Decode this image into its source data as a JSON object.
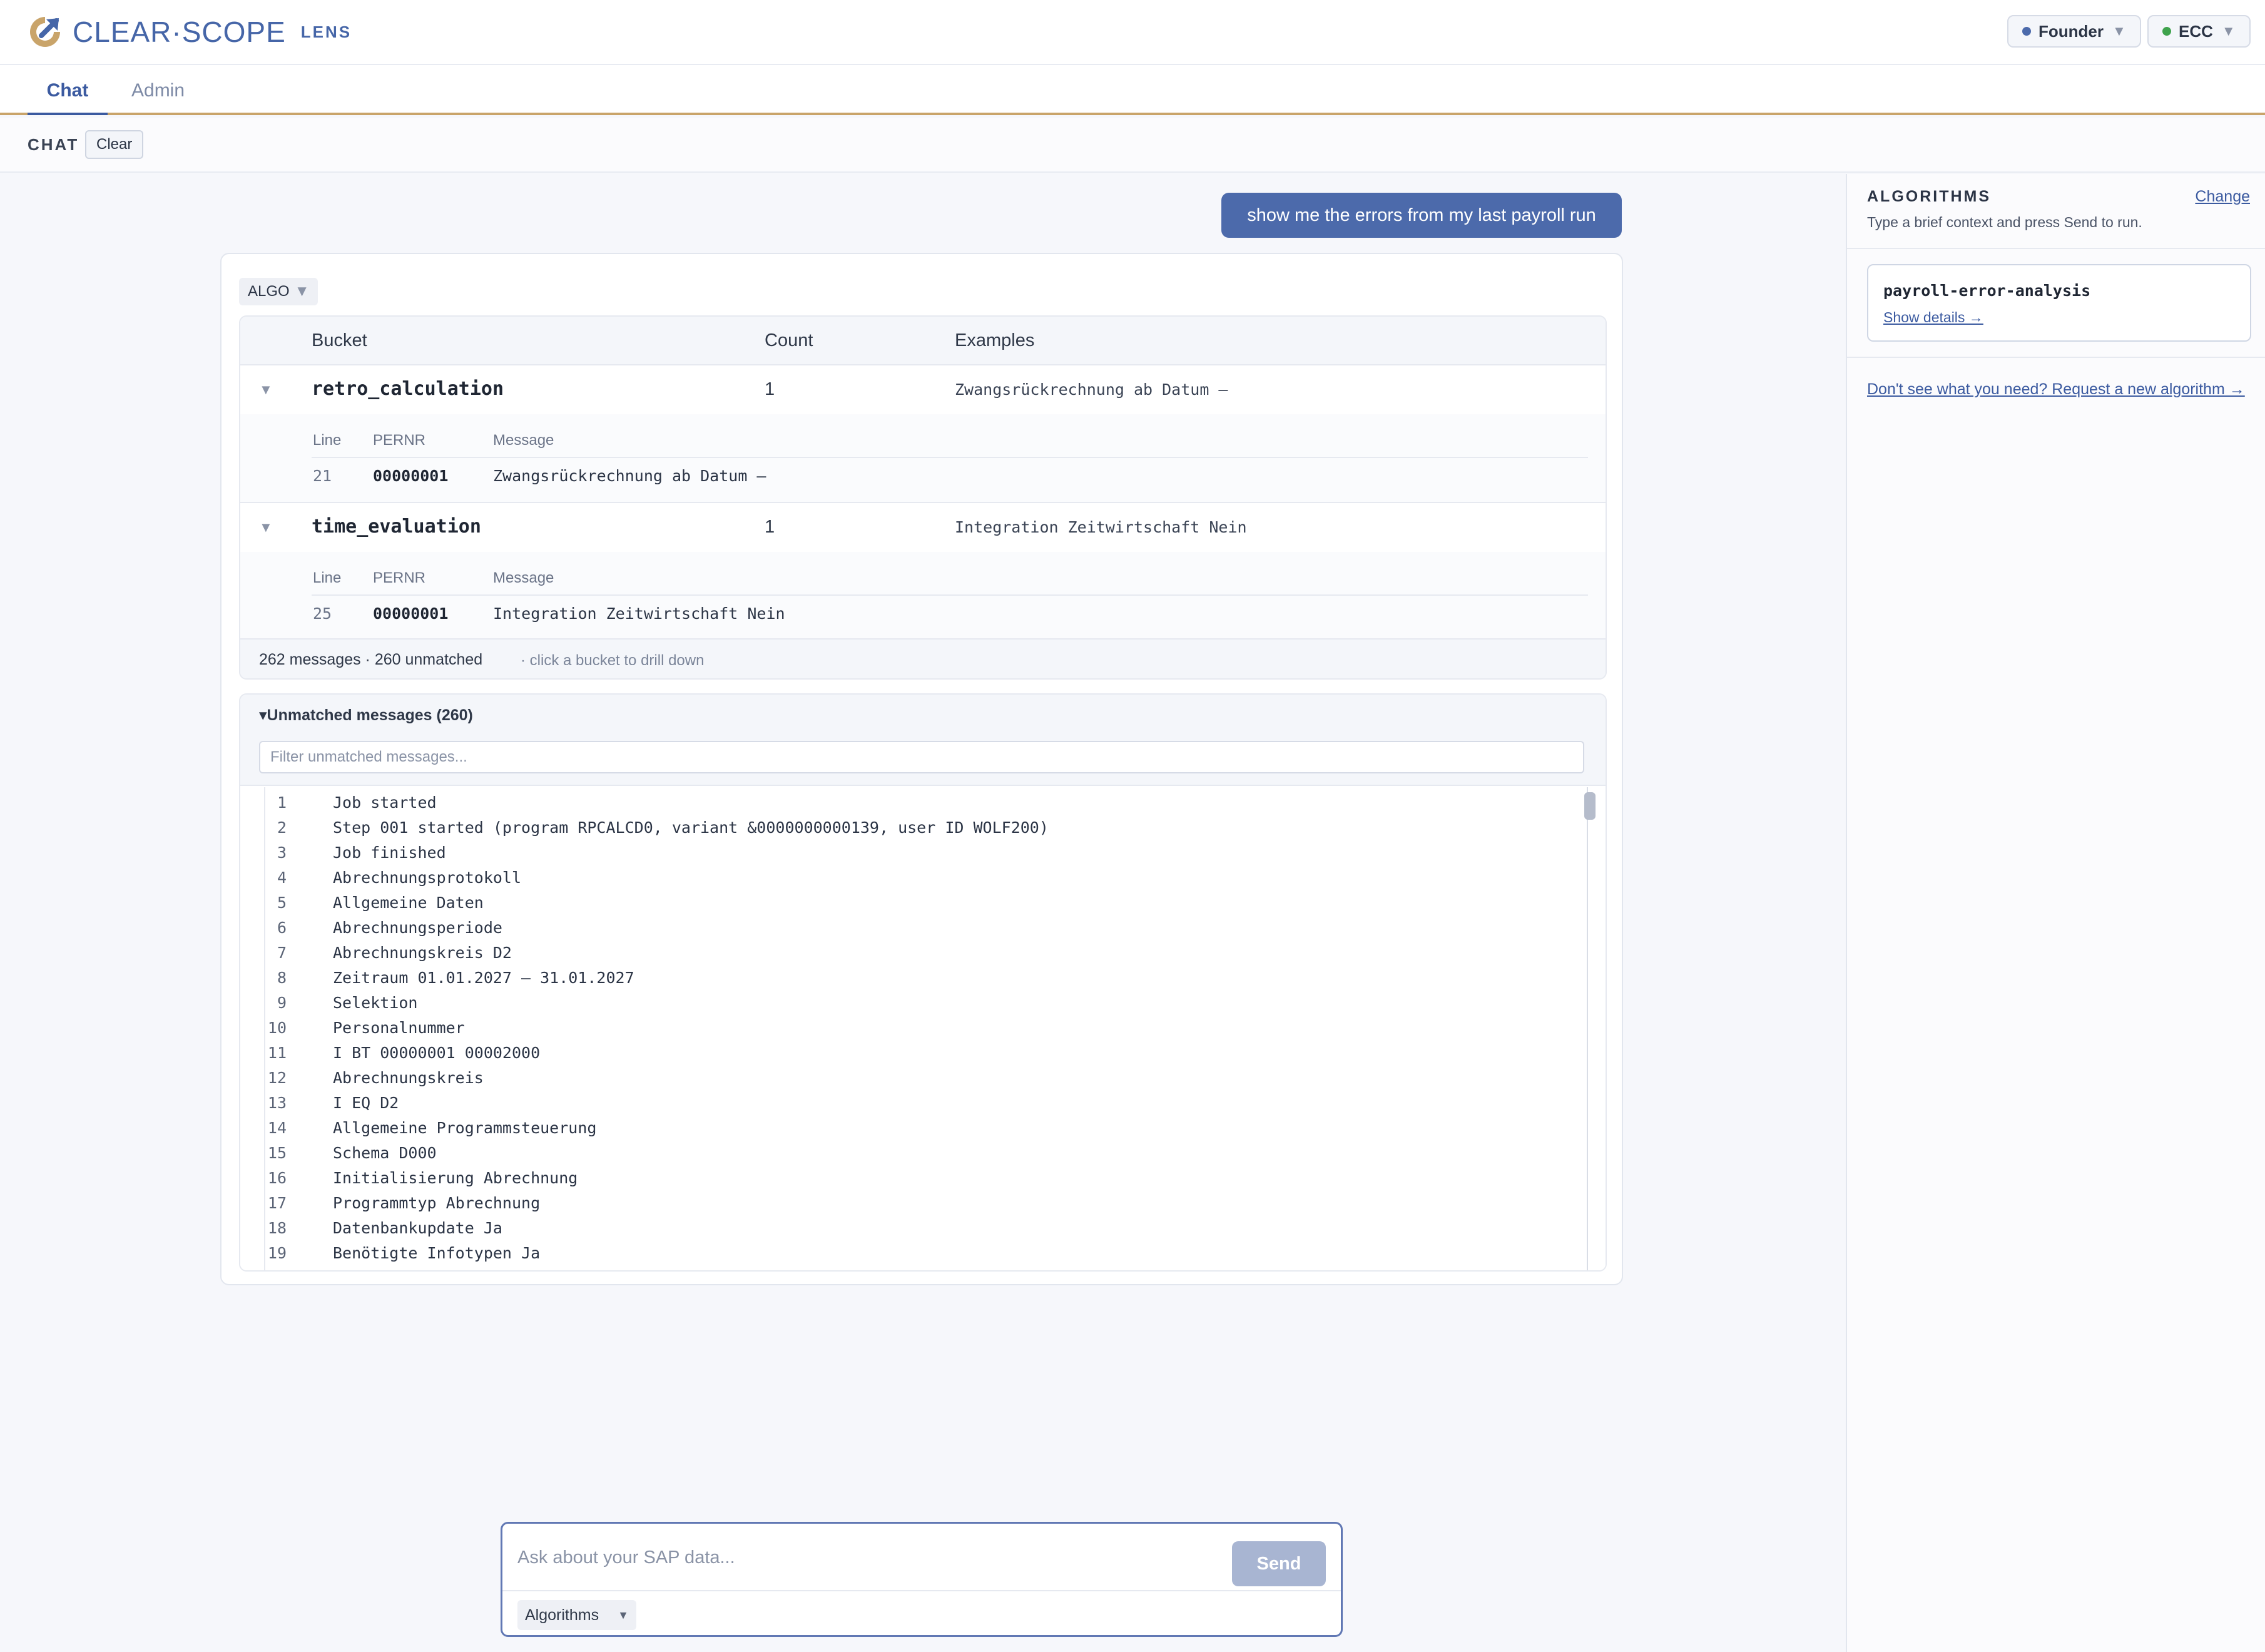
{
  "header": {
    "brand": "CLEAR·SCOPE",
    "brand_sub": "LENS",
    "role_pill": {
      "label": "Founder",
      "dot_color": "#4c6aab"
    },
    "system_pill": {
      "label": "ECC",
      "dot_color": "#3fa34d"
    }
  },
  "tabs": [
    {
      "label": "Chat",
      "active": true
    },
    {
      "label": "Admin",
      "active": false
    }
  ],
  "chat_bar": {
    "label": "CHAT",
    "clear_label": "Clear"
  },
  "conversation": {
    "user_message": "show me the errors from my last payroll run",
    "result": {
      "algo_tag": "ALGO",
      "columns": {
        "bucket": "Bucket",
        "count": "Count",
        "examples": "Examples"
      },
      "detail_columns": {
        "line": "Line",
        "pernr": "PERNR",
        "message": "Message"
      },
      "buckets": [
        {
          "name": "retro_calculation",
          "count": "1",
          "example": "Zwangsrückrechnung ab Datum –",
          "rows": [
            {
              "line": "21",
              "pernr": "00000001",
              "message": "Zwangsrückrechnung ab Datum –"
            }
          ]
        },
        {
          "name": "time_evaluation",
          "count": "1",
          "example": "Integration Zeitwirtschaft Nein",
          "rows": [
            {
              "line": "25",
              "pernr": "00000001",
              "message": "Integration Zeitwirtschaft Nein"
            }
          ]
        }
      ],
      "summary": "262 messages · 260 unmatched",
      "hint": "· click a bucket to drill down",
      "unmatched": {
        "title": "▾Unmatched messages (260)",
        "filter_placeholder": "Filter unmatched messages...",
        "lines": [
          {
            "n": "1",
            "text": "Job started"
          },
          {
            "n": "2",
            "text": "Step 001 started (program RPCALCD0, variant &0000000000139, user ID WOLF200)"
          },
          {
            "n": "3",
            "text": "Job finished"
          },
          {
            "n": "4",
            "text": "Abrechnungsprotokoll"
          },
          {
            "n": "5",
            "text": "Allgemeine Daten"
          },
          {
            "n": "6",
            "text": "Abrechnungsperiode"
          },
          {
            "n": "7",
            "text": "Abrechnungskreis D2"
          },
          {
            "n": "8",
            "text": "Zeitraum 01.01.2027 – 31.01.2027"
          },
          {
            "n": "9",
            "text": "Selektion"
          },
          {
            "n": "10",
            "text": "Personalnummer"
          },
          {
            "n": "11",
            "text": "I BT 00000001 00002000"
          },
          {
            "n": "12",
            "text": "Abrechnungskreis"
          },
          {
            "n": "13",
            "text": "I EQ D2"
          },
          {
            "n": "14",
            "text": "Allgemeine Programmsteuerung"
          },
          {
            "n": "15",
            "text": "Schema D000"
          },
          {
            "n": "16",
            "text": "Initialisierung Abrechnung"
          },
          {
            "n": "17",
            "text": "Programmtyp Abrechnung"
          },
          {
            "n": "18",
            "text": "Datenbankupdate Ja"
          },
          {
            "n": "19",
            "text": "Benötigte Infotypen Ja"
          }
        ]
      }
    }
  },
  "sidebar": {
    "title": "ALGORITHMS",
    "change_label": "Change",
    "subtitle": "Type a brief context and press Send to run.",
    "algorithm": {
      "name": "payroll-error-analysis",
      "details_label": "Show details →"
    },
    "request_link": "Don't see what you need? Request a new algorithm →"
  },
  "composer": {
    "placeholder": "Ask about your SAP data...",
    "send_label": "Send",
    "algorithms_label": "Algorithms"
  },
  "colors": {
    "accent": "#4c6aab",
    "gold": "#c9a46a",
    "send_disabled": "#a8b5d2"
  },
  "icons": {
    "logo": "clearscope-logo-icon",
    "caret": "chevron-down-icon"
  }
}
